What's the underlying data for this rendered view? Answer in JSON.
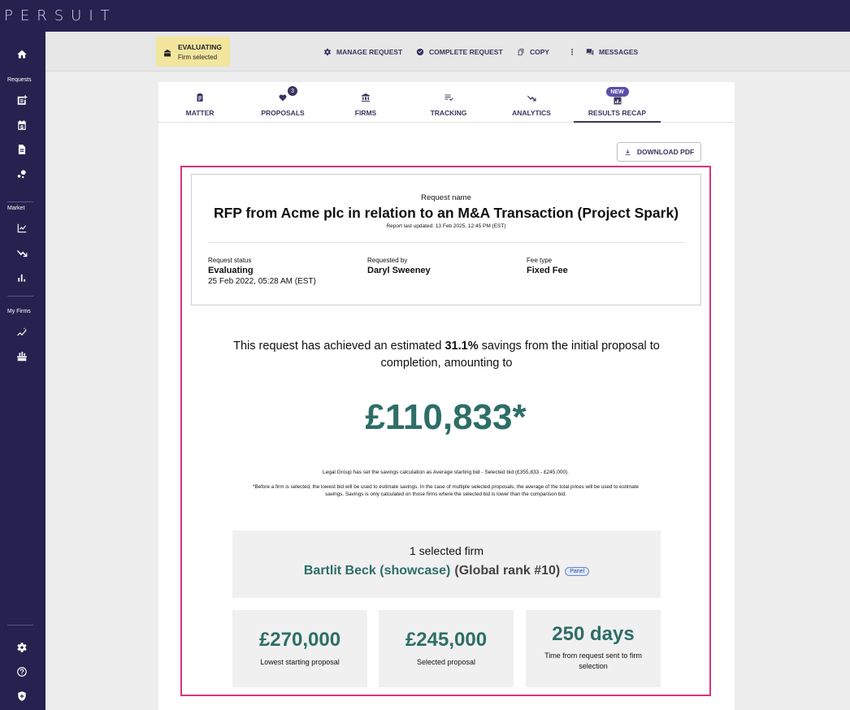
{
  "brand": {
    "logo": "PERSUIT"
  },
  "sidebar": {
    "sections": {
      "requests": "Requests",
      "market": "Market",
      "my_firms": "My Firms"
    }
  },
  "action_bar": {
    "status": {
      "label": "EVALUATING",
      "sub": "Firm selected"
    },
    "manage": "MANAGE REQUEST",
    "complete": "COMPLETE REQUEST",
    "copy": "COPY",
    "messages": "MESSAGES"
  },
  "tabs": [
    {
      "label": "MATTER"
    },
    {
      "label": "PROPOSALS",
      "badge": "3"
    },
    {
      "label": "FIRMS"
    },
    {
      "label": "TRACKING"
    },
    {
      "label": "ANALYTICS"
    },
    {
      "label": "RESULTS RECAP",
      "badge": "NEW",
      "active": true
    }
  ],
  "download_pdf": "DOWNLOAD PDF",
  "summary": {
    "caption": "Request name",
    "title": "RFP from Acme plc in relation to an M&A Transaction (Project Spark)",
    "updated": "Report last updated: 13 Feb 2025, 12:45 PM (EST)",
    "status_label": "Request status",
    "status_value": "Evaluating",
    "status_date": "25 Feb 2022, 05:28 AM (EST)",
    "requested_label": "Requested by",
    "requested_value": "Daryl Sweeney",
    "fee_label": "Fee type",
    "fee_value": "Fixed Fee"
  },
  "savings": {
    "prefix": "This request has achieved an estimated ",
    "percent": "31.1%",
    "suffix": " savings from the initial proposal to completion, amounting to",
    "amount": "£110,833*",
    "calc_prefix": "Legal Group has set the savings calculation as ",
    "calc_formula": "Average starting bid - Selected bid (£355,833 - £245,000).",
    "footnote": "*Before a firm is selected, the lowest bid will be used to estimate savings. In the case of multiple selected proposals, the average of the total prices will be used to estimate savings. Savings is only calculated on those firms where the selected bid is lower than the comparison bid."
  },
  "selected_firm": {
    "count": "1 selected firm",
    "name": "Bartlit Beck (showcase)",
    "rank": "(Global rank #10)",
    "tag": "Panel"
  },
  "stats": [
    {
      "value": "£270,000",
      "label": "Lowest starting proposal"
    },
    {
      "value": "£245,000",
      "label": "Selected proposal"
    },
    {
      "value": "250 days",
      "label": "Time from request sent to firm selection"
    }
  ]
}
